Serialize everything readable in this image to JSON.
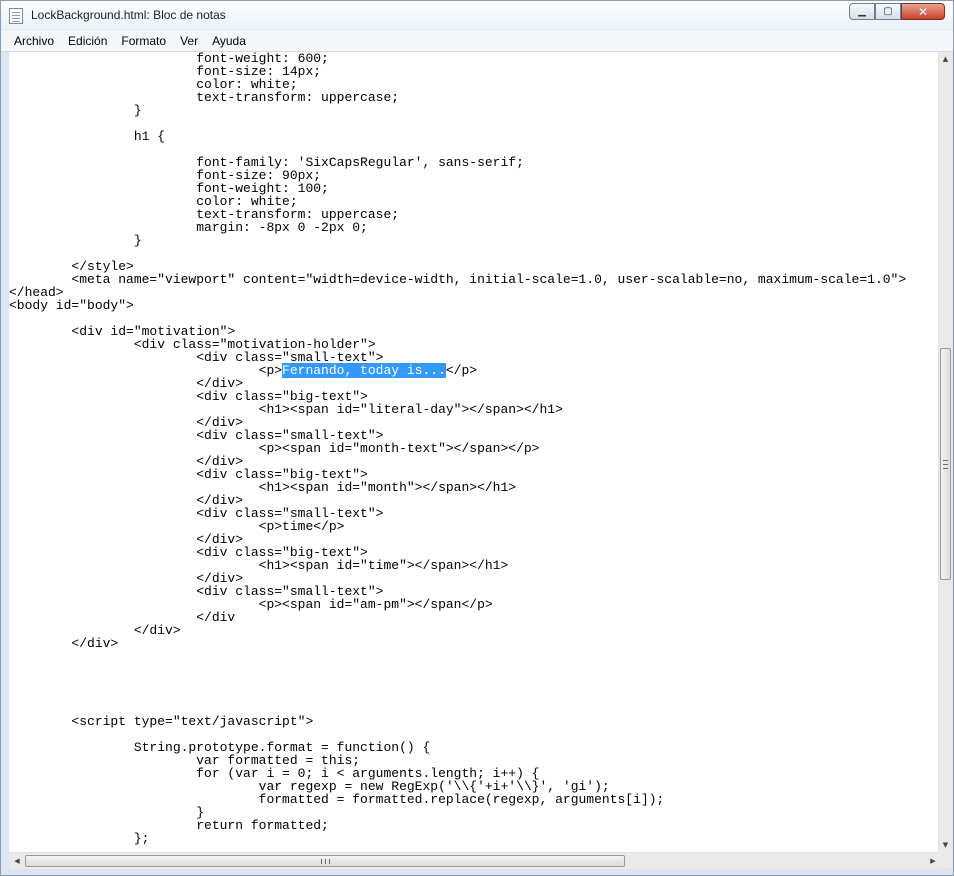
{
  "window": {
    "title": "LockBackground.html: Bloc de notas",
    "minimize_glyph": "▁",
    "maximize_glyph": "▢",
    "close_glyph": "✕"
  },
  "menu": [
    "Archivo",
    "Edición",
    "Formato",
    "Ver",
    "Ayuda"
  ],
  "editor": {
    "lines": [
      "                        font-weight: 600;",
      "                        font-size: 14px;",
      "                        color: white;",
      "                        text-transform: uppercase;",
      "                }",
      "",
      "                h1 {",
      "",
      "                        font-family: 'SixCapsRegular', sans-serif;",
      "                        font-size: 90px;",
      "                        font-weight: 100;",
      "                        color: white;",
      "                        text-transform: uppercase;",
      "                        margin: -8px 0 -2px 0;",
      "                }",
      "",
      "        </style>",
      "        <meta name=\"viewport\" content=\"width=device-width, initial-scale=1.0, user-scalable=no, maximum-scale=1.0\">",
      "</head>",
      "<body id=\"body\">",
      "",
      "        <div id=\"motivation\">",
      "                <div class=\"motivation-holder\">",
      "                        <div class=\"small-text\">",
      "                                <p>{{SEL}}</p>",
      "                        </div>",
      "                        <div class=\"big-text\">",
      "                                <h1><span id=\"literal-day\"></span></h1>",
      "                        </div>",
      "                        <div class=\"small-text\">",
      "                                <p><span id=\"month-text\"></span></p>",
      "                        </div>",
      "                        <div class=\"big-text\">",
      "                                <h1><span id=\"month\"></span></h1>",
      "                        </div>",
      "                        <div class=\"small-text\">",
      "                                <p>time</p>",
      "                        </div>",
      "                        <div class=\"big-text\">",
      "                                <h1><span id=\"time\"></span></h1>",
      "                        </div>",
      "                        <div class=\"small-text\">",
      "                                <p><span id=\"am-pm\"></span</p>",
      "                        </div",
      "                </div>",
      "        </div>",
      "",
      "",
      "",
      "",
      "",
      "        <script type=\"text/javascript\">",
      "",
      "                String.prototype.format = function() {",
      "                        var formatted = this;",
      "                        for (var i = 0; i < arguments.length; i++) {",
      "                                var regexp = new RegExp('\\\\{'+i+'\\\\}', 'gi');",
      "                                formatted = formatted.replace(regexp, arguments[i]);",
      "                        }",
      "                        return formatted;",
      "                };"
    ],
    "selected_text": "Fernando, today is..."
  },
  "scrollbars": {
    "up_glyph": "▲",
    "down_glyph": "▼",
    "left_glyph": "◀",
    "right_glyph": "▶"
  }
}
